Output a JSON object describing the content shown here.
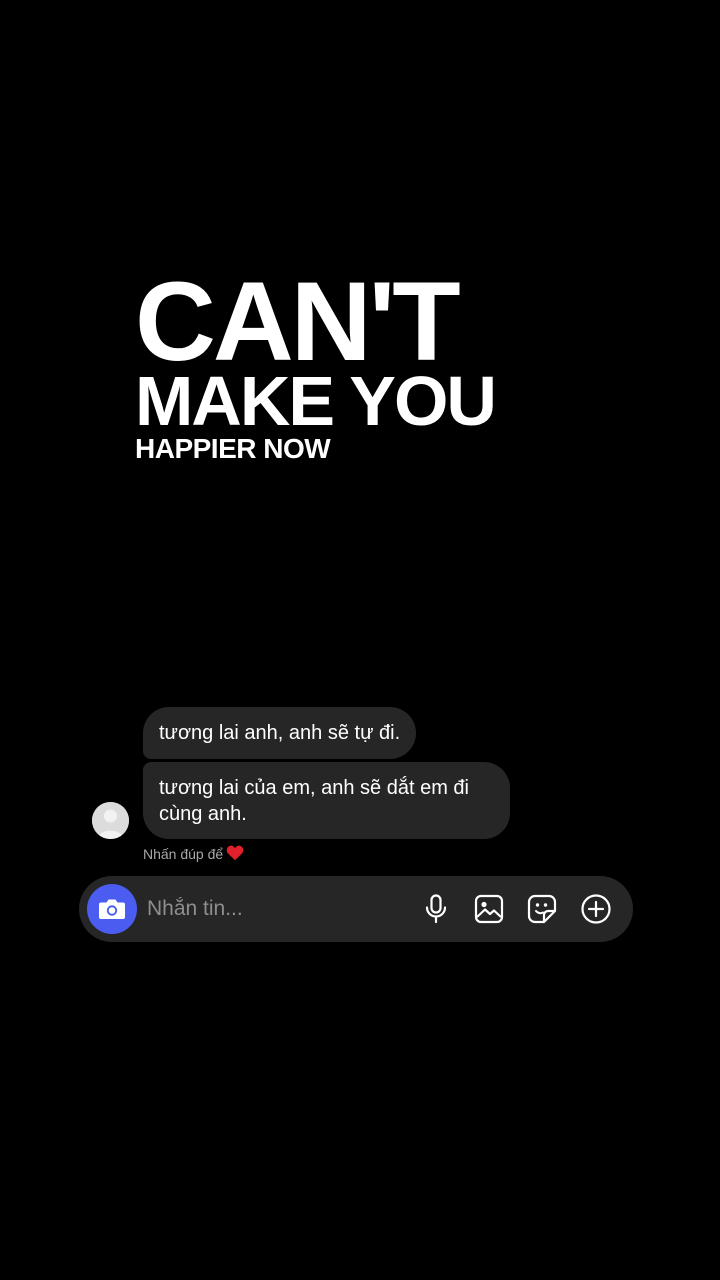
{
  "title": {
    "line1": "CAN'T",
    "line2": "MAKE YOU",
    "line3": "HAPPIER NOW"
  },
  "messages": [
    {
      "text": "tương lai anh, anh sẽ tự đi."
    },
    {
      "text": "tương lai của em, anh sẽ dắt em đi cùng anh."
    }
  ],
  "double_tap_hint": "Nhấn đúp để",
  "composer": {
    "placeholder": "Nhắn tin...",
    "icons": [
      "camera-icon",
      "microphone-icon",
      "gallery-icon",
      "sticker-icon",
      "plus-circle-icon"
    ]
  },
  "colors": {
    "background": "#000000",
    "bubble": "#262626",
    "composer": "#262626",
    "camera_button": "#4a5df0",
    "heart": "#e0202a",
    "hint_text": "#a8a8a8"
  }
}
